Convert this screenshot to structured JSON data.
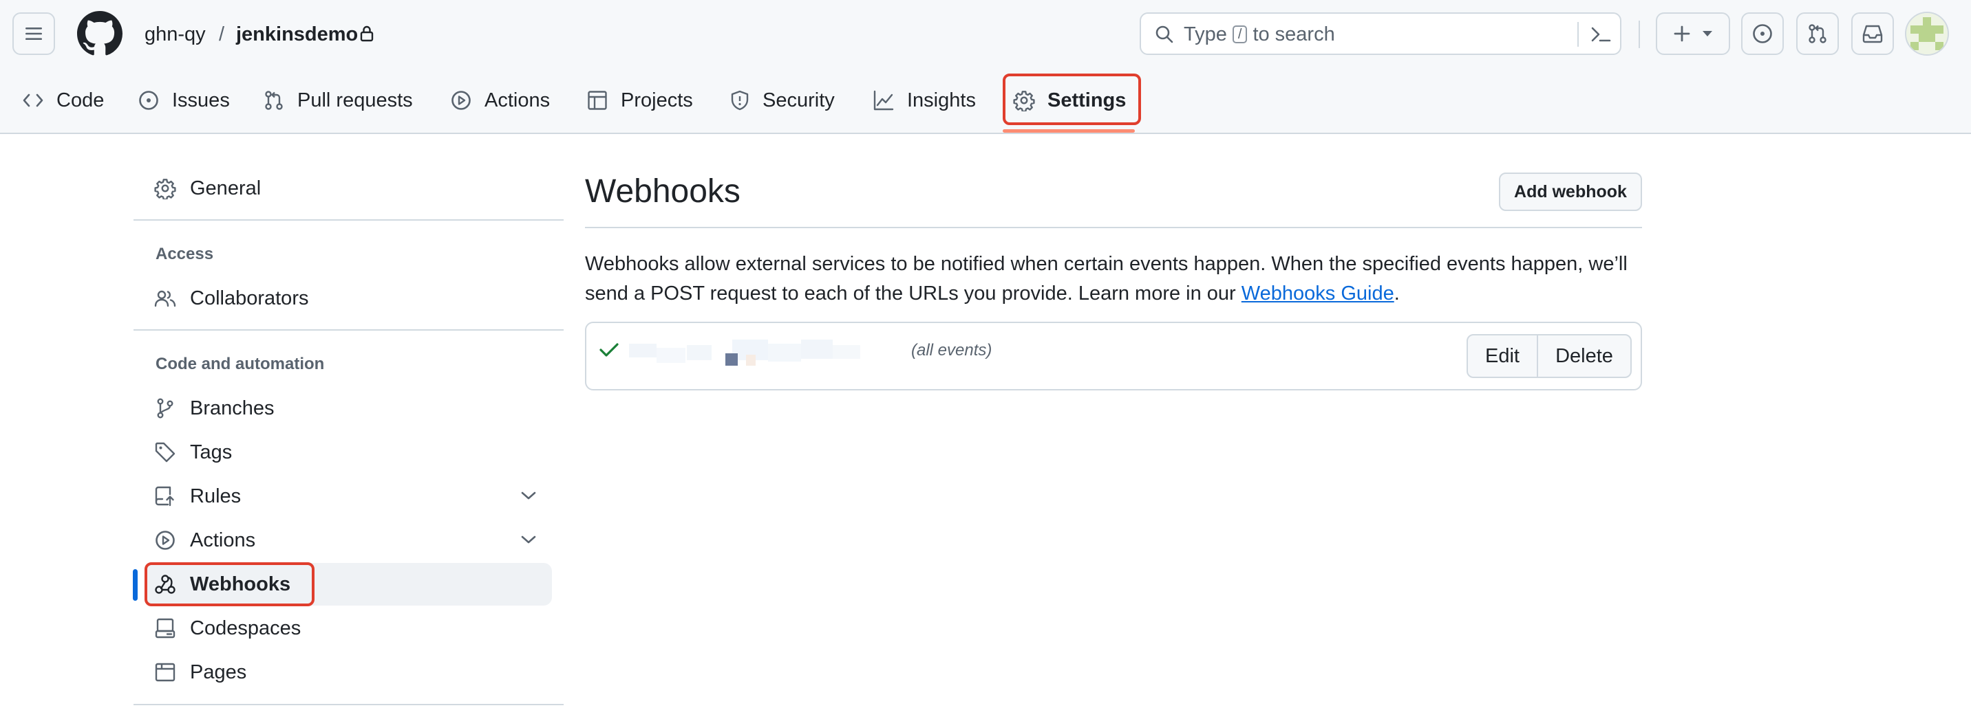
{
  "header": {
    "owner": "ghn-qy",
    "separator": "/",
    "repo": "jenkinsdemo",
    "search": {
      "prefix": "Type",
      "key": "/",
      "suffix": "to search"
    }
  },
  "repo_nav": [
    {
      "label": "Code",
      "icon": "code-icon"
    },
    {
      "label": "Issues",
      "icon": "issue-opened-icon"
    },
    {
      "label": "Pull requests",
      "icon": "git-pull-request-icon"
    },
    {
      "label": "Actions",
      "icon": "play-icon"
    },
    {
      "label": "Projects",
      "icon": "table-icon"
    },
    {
      "label": "Security",
      "icon": "shield-icon"
    },
    {
      "label": "Insights",
      "icon": "graph-icon"
    },
    {
      "label": "Settings",
      "icon": "gear-icon",
      "active": true
    }
  ],
  "sidebar": {
    "general": "General",
    "access_heading": "Access",
    "collaborators": "Collaborators",
    "code_heading": "Code and automation",
    "branches": "Branches",
    "tags": "Tags",
    "rules": "Rules",
    "actions": "Actions",
    "webhooks": "Webhooks",
    "codespaces": "Codespaces",
    "pages": "Pages"
  },
  "main": {
    "title": "Webhooks",
    "add_button": "Add webhook",
    "description_prefix": "Webhooks allow external services to be notified when certain events happen. When the specified events happen, we’ll send a POST request to each of the URLs you provide. Learn more in our ",
    "guide_link": "Webhooks Guide",
    "description_suffix": ".",
    "webhook": {
      "events": "(all events)",
      "edit_label": "Edit",
      "delete_label": "Delete",
      "status_color": "#1a7f37"
    }
  },
  "colors": {
    "accent": "#0969da",
    "nav_underline": "#fd8c73",
    "highlight_box": "#e03e2d"
  }
}
